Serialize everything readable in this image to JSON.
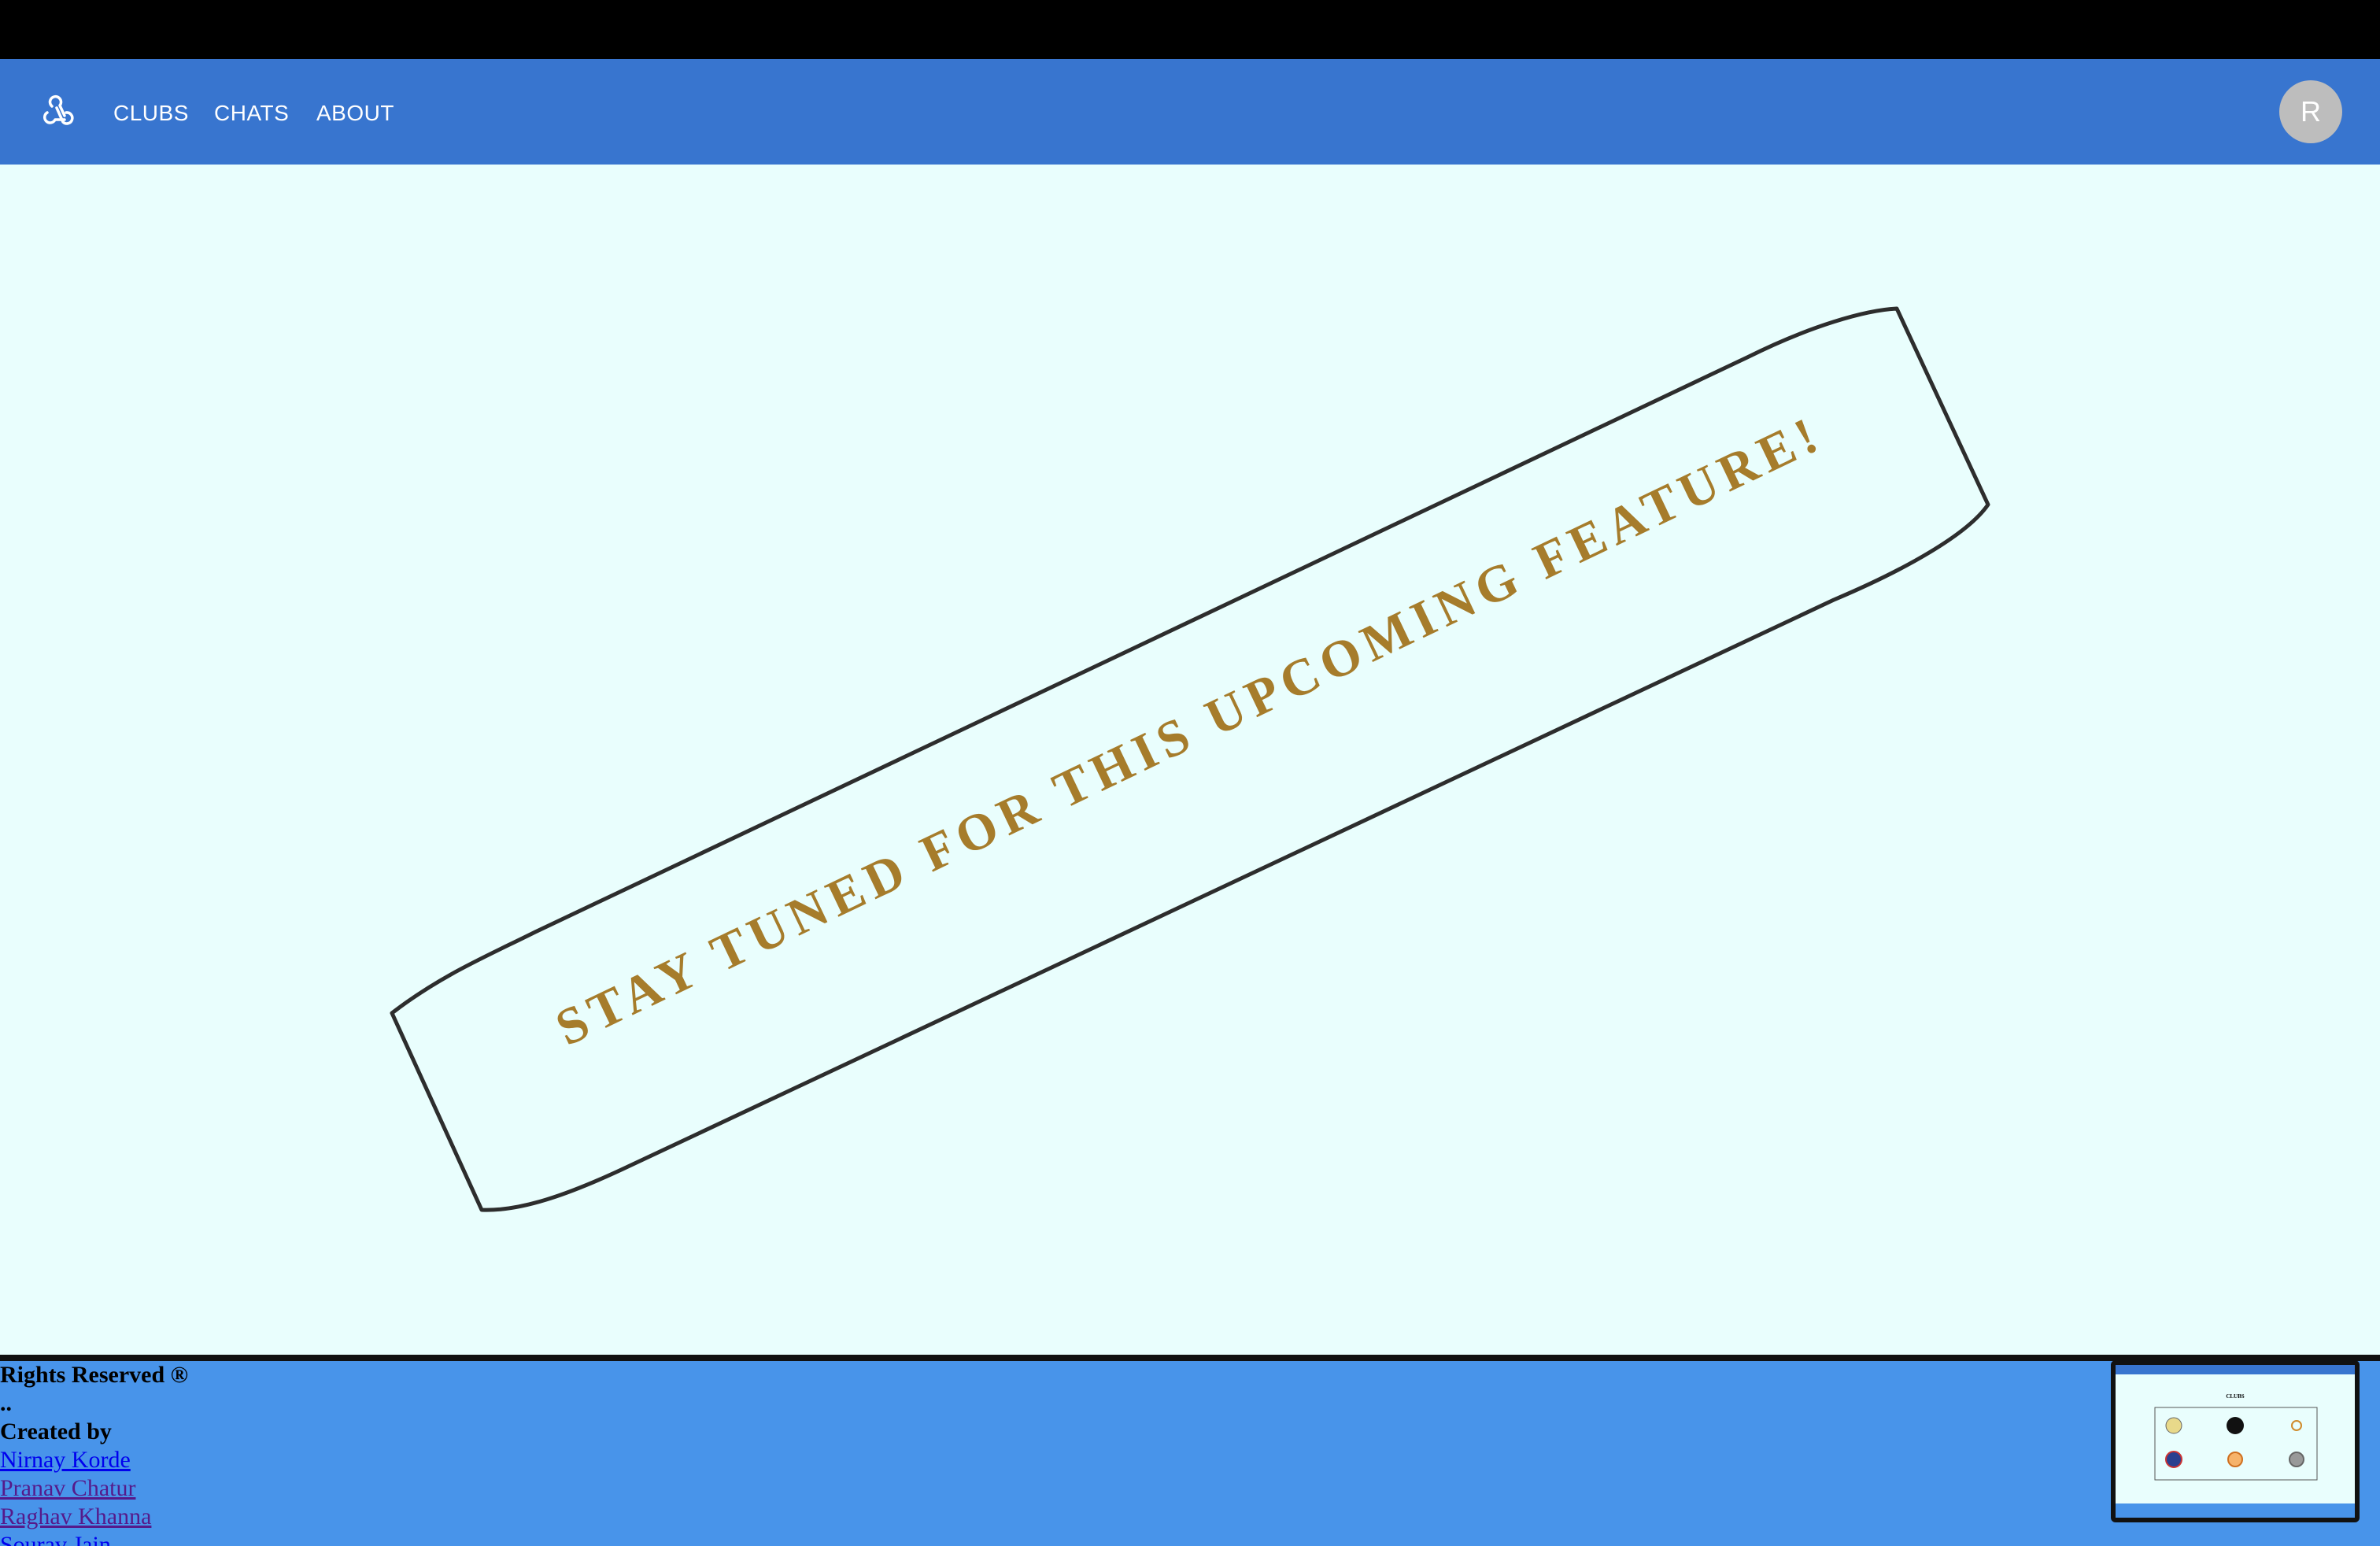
{
  "nav": {
    "links": [
      "CLUBS",
      "CHATS",
      "ABOUT"
    ],
    "avatar_initial": "R"
  },
  "main": {
    "banner_text": "STAY TUNED FOR THIS UPCOMING FEATURE!"
  },
  "footer": {
    "rights": "Rights Reserved ®",
    "dots": "..",
    "created_by": "Created by",
    "authors": [
      "Nirnay Korde",
      "Pranav Chatur",
      "Raghav Khanna",
      "Sourav Jain"
    ]
  },
  "thumbnail": {
    "title": "CLUBS"
  },
  "colors": {
    "navbar": "#3875cf",
    "page_background": "#e9fefd",
    "footer": "#4894ea",
    "banner_text": "#a67c2b",
    "avatar": "#bdbdbd"
  }
}
